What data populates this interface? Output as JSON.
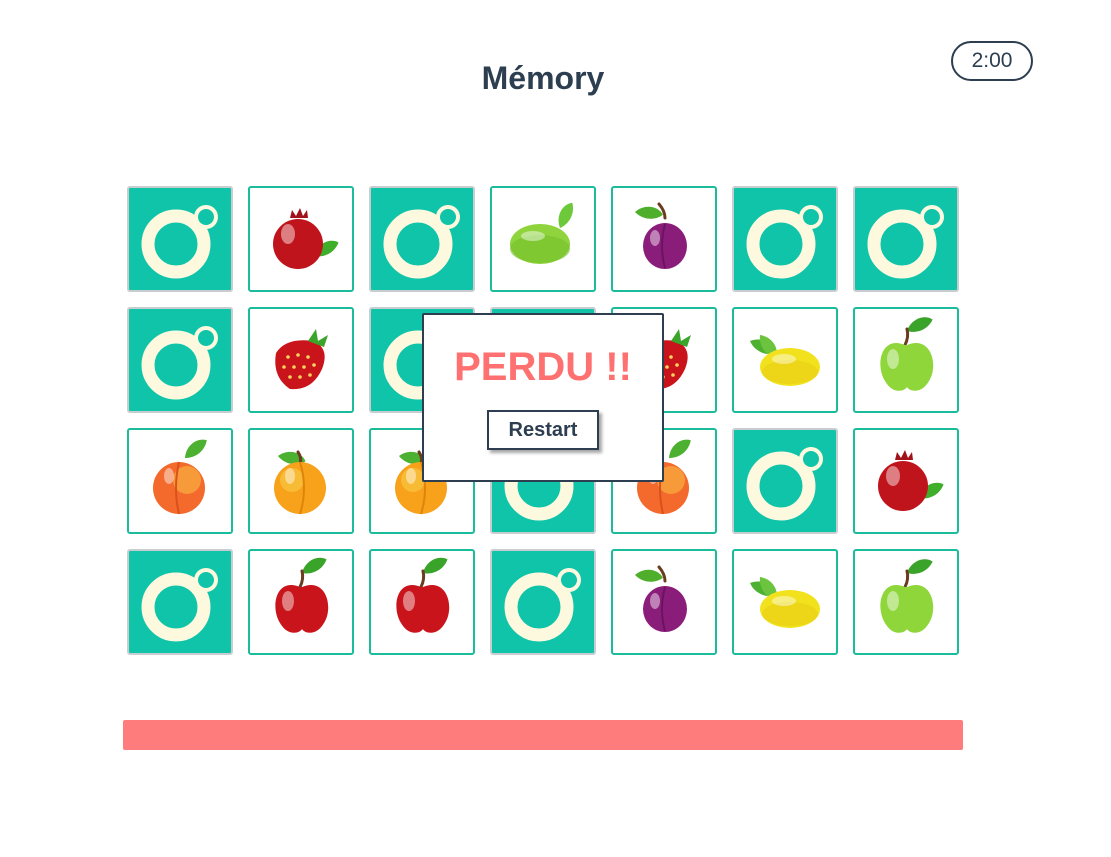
{
  "game": {
    "title": "Mémory",
    "timer": "2:00"
  },
  "colors": {
    "card_back": "#10c4a9",
    "card_border": "#1abc9c",
    "ring": "#fdf9df",
    "title": "#2c3e50",
    "lost": "#ff7070",
    "progress": "#ff7c7c"
  },
  "board": {
    "columns": 7,
    "rows": [
      [
        "hidden",
        "pomegranate",
        "hidden",
        "lime",
        "plum",
        "hidden",
        "hidden"
      ],
      [
        "hidden",
        "strawberry",
        "hidden",
        "hidden",
        "strawberry",
        "lemon",
        "green-apple"
      ],
      [
        "peach",
        "apricot",
        "apricot",
        "hidden",
        "peach",
        "hidden",
        "pomegranate"
      ],
      [
        "hidden",
        "red-apple",
        "red-apple",
        "hidden",
        "plum",
        "lemon",
        "green-apple"
      ]
    ]
  },
  "progress": {
    "value": 1.0
  },
  "modal": {
    "title": "PERDU !!",
    "restart_label": "Restart"
  }
}
